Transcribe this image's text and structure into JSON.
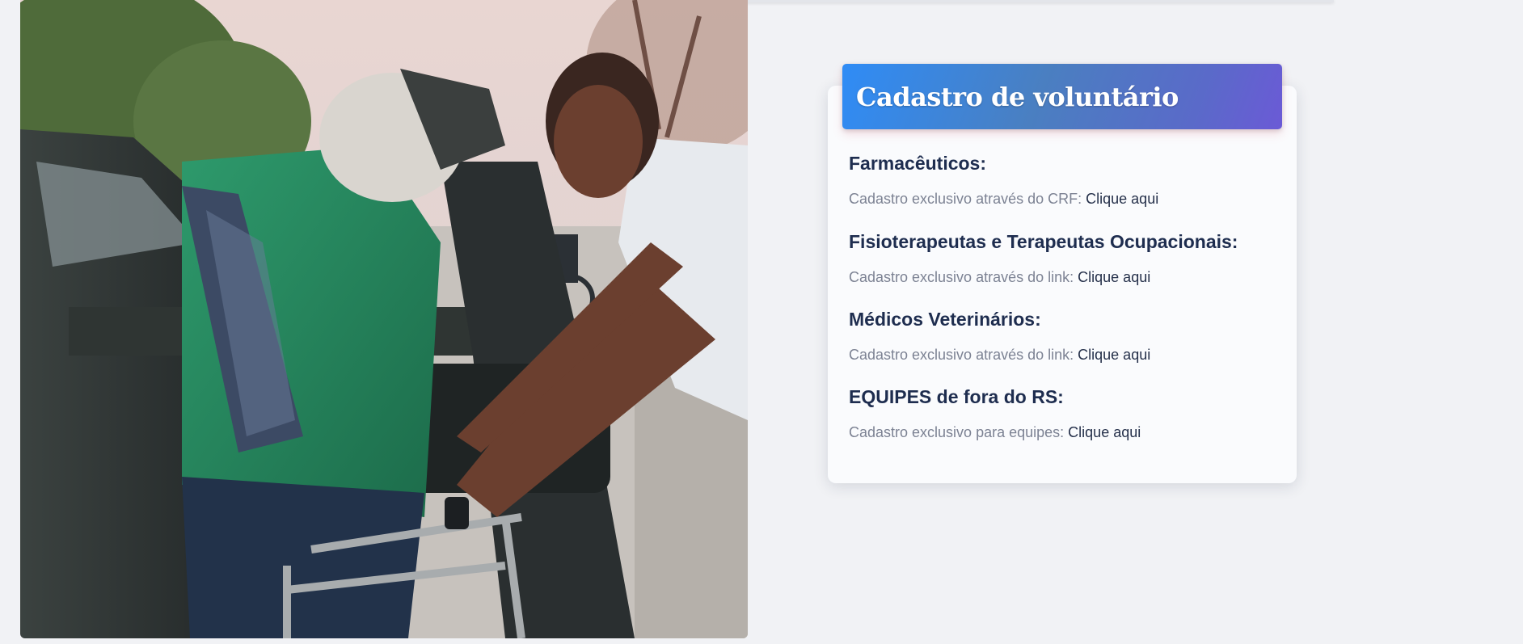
{
  "card": {
    "title": "Cadastro de voluntário",
    "sections": [
      {
        "heading": "Farmacêuticos:",
        "text": "Cadastro exclusivo através do CRF:",
        "link": "Clique aqui"
      },
      {
        "heading": "Fisioterapeutas e Terapeutas Ocupacionais:",
        "text": "Cadastro exclusivo através do link:",
        "link": "Clique aqui"
      },
      {
        "heading": "Médicos Veterinários:",
        "text": "Cadastro exclusivo através do link:",
        "link": "Clique aqui"
      },
      {
        "heading": "EQUIPES de fora do RS:",
        "text": "Cadastro exclusivo para equipes:",
        "link": "Clique aqui"
      }
    ]
  },
  "colors": {
    "background": "#f1f2f5",
    "header_gradient_start": "#2f8cf6",
    "header_gradient_end": "#6b5ad6",
    "heading": "#1e2d4f",
    "body_text": "#7c8293",
    "link": "#25304a"
  }
}
